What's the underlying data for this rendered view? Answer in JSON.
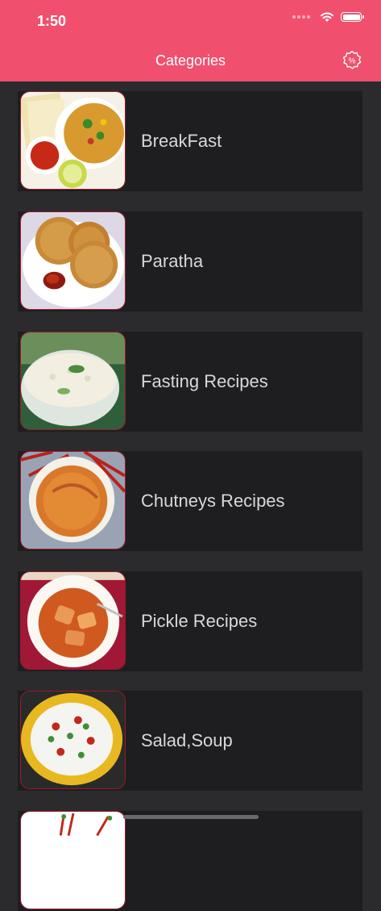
{
  "status_bar": {
    "time": "1:50"
  },
  "header": {
    "title": "Categories",
    "settings_icon": "percent-badge-icon"
  },
  "categories": [
    {
      "label": "BreakFast"
    },
    {
      "label": "Paratha"
    },
    {
      "label": "Fasting Recipes"
    },
    {
      "label": "Chutneys Recipes"
    },
    {
      "label": "Pickle Recipes"
    },
    {
      "label": "Salad,Soup"
    }
  ],
  "colors": {
    "accent": "#f0506e",
    "background": "#2b2b2d",
    "card": "#1e1e20",
    "thumb_border": "#9c1a28"
  }
}
